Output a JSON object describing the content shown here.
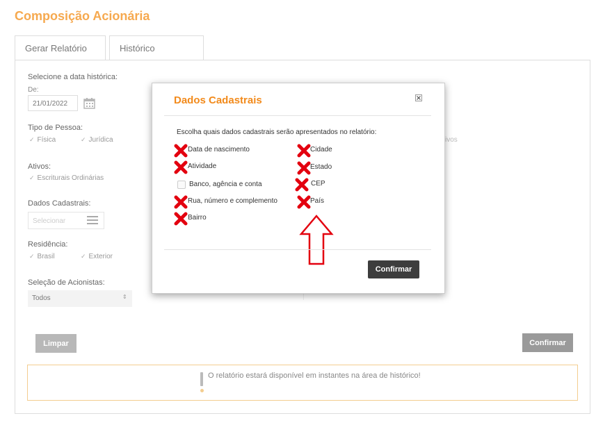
{
  "page": {
    "title": "Composição Acionária"
  },
  "tabs": [
    {
      "label": "Gerar Relatório"
    },
    {
      "label": "Histórico"
    }
  ],
  "form": {
    "date_section_label": "Selecione a data histórica:",
    "from_label": "De:",
    "from_value": "21/01/2022",
    "pessoa_label": "Tipo de Pessoa:",
    "pessoa_options": [
      "Física",
      "Jurídica"
    ],
    "ativos_label": "Ativos:",
    "ativos_options": [
      "Escriturais Ordinárias"
    ],
    "dados_label": "Dados Cadastrais:",
    "dados_placeholder": "Selecionar",
    "residencia_label": "Residência:",
    "residencia_options": [
      "Brasil",
      "Exterior"
    ],
    "acionistas_label": "Seleção de Acionistas:",
    "acionistas_value": "Todos",
    "ghost_text": "ivos"
  },
  "buttons": {
    "clear": "Limpar",
    "confirm": "Confirmar"
  },
  "notice": {
    "text": "O relatório estará disponível em instantes na área de histórico!"
  },
  "modal": {
    "title": "Dados Cadastrais",
    "instruction": "Escolha quais dados cadastrais serão apresentados no relatório:",
    "left_options": [
      "Data de nascimento",
      "Atividade",
      "Banco, agência e conta",
      "Rua, número e complemento",
      "Bairro"
    ],
    "right_options": [
      "Cidade",
      "Estado",
      "CEP",
      "País"
    ],
    "confirm": "Confirmar"
  },
  "colors": {
    "title_orange": "#f6a94f",
    "modal_title": "#f28a1b",
    "annotation_red": "#e3000f",
    "notice_border": "#f3cd8f"
  }
}
